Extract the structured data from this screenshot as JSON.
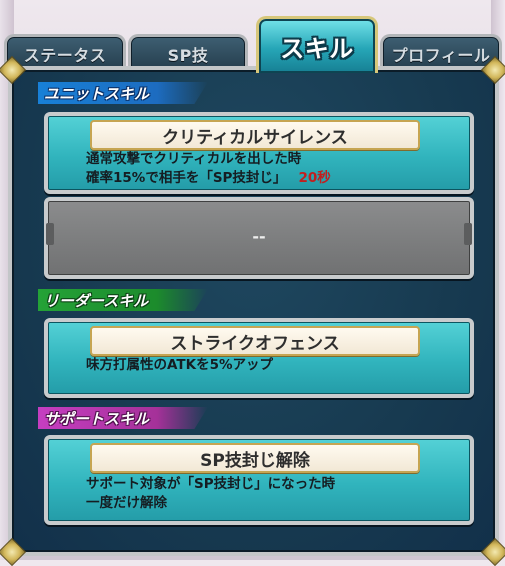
{
  "tabs": [
    {
      "label": "ステータス",
      "active": false
    },
    {
      "label": "SP技",
      "active": false
    },
    {
      "label": "スキル",
      "active": true
    },
    {
      "label": "プロフィール",
      "active": false
    }
  ],
  "sections": {
    "unit": {
      "title": "ユニットスキル",
      "skill1": {
        "name": "クリティカルサイレンス",
        "line1": "通常攻撃でクリティカルを出した時",
        "line2": "確率15%で相手を「SP技封じ」",
        "duration": "20秒"
      },
      "skill2": {
        "empty_text": "--"
      }
    },
    "leader": {
      "title": "リーダースキル",
      "skill": {
        "name": "ストライクオフェンス",
        "line1": "味方打属性のATKを5%アップ"
      }
    },
    "support": {
      "title": "サポートスキル",
      "skill": {
        "name": "SP技封じ解除",
        "line1": "サポート対象が「SP技封じ」になった時",
        "line2": "一度だけ解除"
      }
    }
  },
  "colors": {
    "unit_header": "#1880d7",
    "leader_header": "#24a237",
    "support_header": "#c53ec1",
    "skill_box": "#31b4bd",
    "duration_red": "#c21f1f"
  }
}
